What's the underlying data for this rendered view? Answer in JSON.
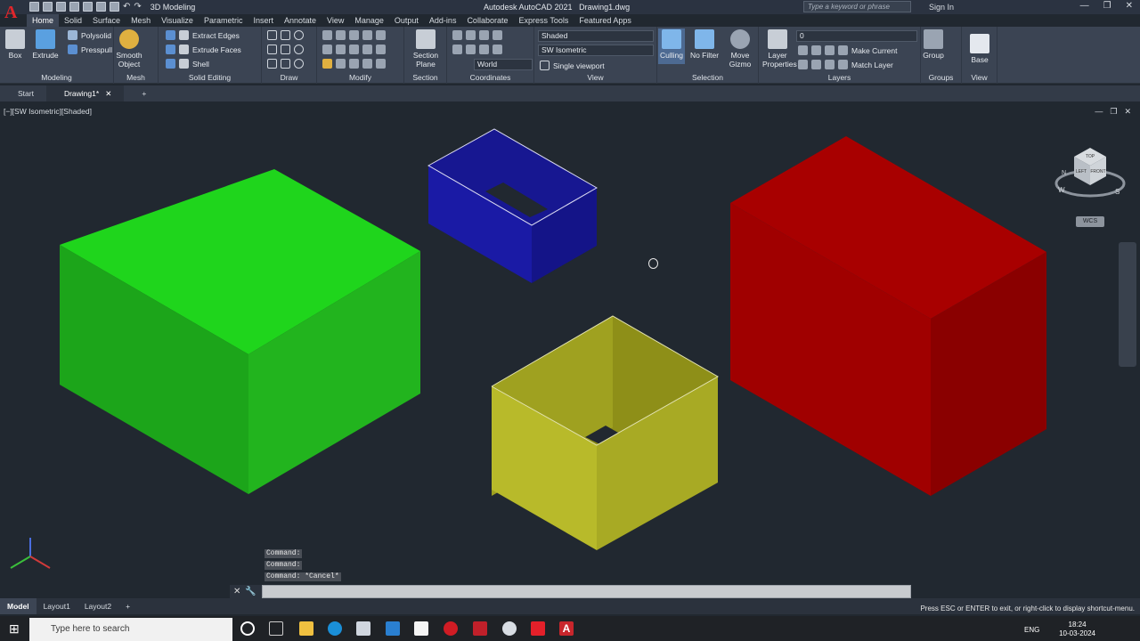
{
  "app": {
    "title": "Autodesk AutoCAD 2021",
    "document": "Drawing1.dwg",
    "workspace": "3D Modeling",
    "search_placeholder": "Type a keyword or phrase",
    "sign_in": "Sign In"
  },
  "ribbon_tabs": [
    "Home",
    "Solid",
    "Surface",
    "Mesh",
    "Visualize",
    "Parametric",
    "Insert",
    "Annotate",
    "View",
    "Manage",
    "Output",
    "Add-ins",
    "Collaborate",
    "Express Tools",
    "Featured Apps"
  ],
  "ribbon": {
    "modeling": {
      "label": "Modeling",
      "box": "Box",
      "extrude": "Extrude",
      "polysolid": "Polysolid",
      "presspull": "Presspull"
    },
    "mesh": {
      "label": "Mesh",
      "smooth": "Smooth",
      "object": "Object"
    },
    "solid_editing": {
      "label": "Solid Editing",
      "extract_edges": "Extract Edges",
      "extrude_faces": "Extrude Faces",
      "shell": "Shell"
    },
    "draw": {
      "label": "Draw"
    },
    "modify": {
      "label": "Modify"
    },
    "section": {
      "label": "Section",
      "btn1": "Section",
      "btn2": "Plane"
    },
    "coordinates": {
      "label": "Coordinates",
      "world": "World"
    },
    "view": {
      "label": "View",
      "visual_style": "Shaded",
      "view_name": "SW Isometric",
      "viewport": "Single viewport"
    },
    "selection": {
      "label": "Selection",
      "culling": "Culling",
      "no_filter": "No Filter",
      "move1": "Move",
      "move2": "Gizmo"
    },
    "layers": {
      "label": "Layers",
      "layer1": "Layer",
      "layer2": "Properties",
      "layer_value": "0",
      "make_current": "Make Current",
      "match_layer": "Match Layer"
    },
    "groups": {
      "label": "Groups",
      "group": "Group"
    },
    "view2": {
      "label": "View",
      "base": "Base"
    }
  },
  "doc_tabs": {
    "start": "Start",
    "drawing": "Drawing1*"
  },
  "viewport": {
    "label": "[−][SW Isometric][Shaded]",
    "wcs": "WCS"
  },
  "viewcube": {
    "top": "TOP",
    "left": "LEFT",
    "front": "FRONT",
    "n": "N",
    "w": "W",
    "s": "S"
  },
  "command_history": [
    "Command:",
    "Command:",
    "Command: *Cancel*"
  ],
  "layout_tabs": [
    "Model",
    "Layout1",
    "Layout2"
  ],
  "status_message": "Press ESC or ENTER to exit, or right-click to display shortcut-menu.",
  "taskbar": {
    "search": "Type here to search",
    "lang": "ENG",
    "time": "18:24",
    "date": "10-03-2024"
  },
  "colors": {
    "green": "#21c21b",
    "blue": "#1c1ca6",
    "yellow": "#b6b82a",
    "red": "#a30000",
    "background": "#212830"
  }
}
